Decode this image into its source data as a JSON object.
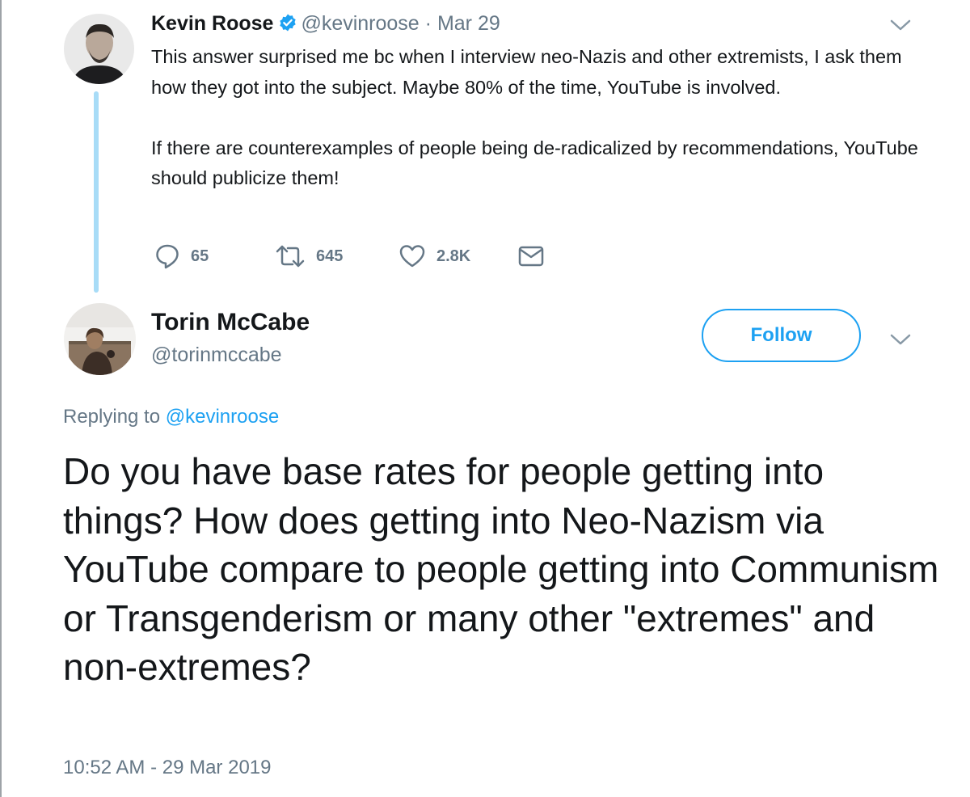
{
  "parent_tweet": {
    "author_name": "Kevin Roose",
    "handle": "@kevinroose",
    "date": "· Mar 29",
    "paragraphs": [
      "This answer surprised me bc when I interview neo-Nazis and other extremists, I ask them how they got into the subject. Maybe 80% of the time, YouTube is involved.",
      "If there are counterexamples of people being de-radicalized by recommendations, YouTube should publicize them!"
    ],
    "actions": {
      "reply_count": "65",
      "retweet_count": "645",
      "like_count": "2.8K"
    },
    "avatar_icon": "person-avatar"
  },
  "reply_tweet": {
    "author_name": "Torin McCabe",
    "handle": "@torinmccabe",
    "follow_label": "Follow",
    "replying_prefix": "Replying to",
    "replying_to": "@kevinroose",
    "text": "Do you have base rates for people getting into things?  How does getting into Neo-Nazism via YouTube compare to people getting into Communism or Transgenderism or many other \"extremes\" and non-extremes?",
    "timestamp": "10:52 AM - 29 Mar 2019",
    "avatar_icon": "person-avatar"
  },
  "colors": {
    "accent": "#1da1f2",
    "muted_text": "#657786",
    "thread_line": "#a8dcf7",
    "verified_badge": "#1da1f2"
  },
  "icons": [
    "verified-badge-icon",
    "chevron-down-icon",
    "reply-icon",
    "retweet-icon",
    "like-icon",
    "direct-message-icon"
  ]
}
